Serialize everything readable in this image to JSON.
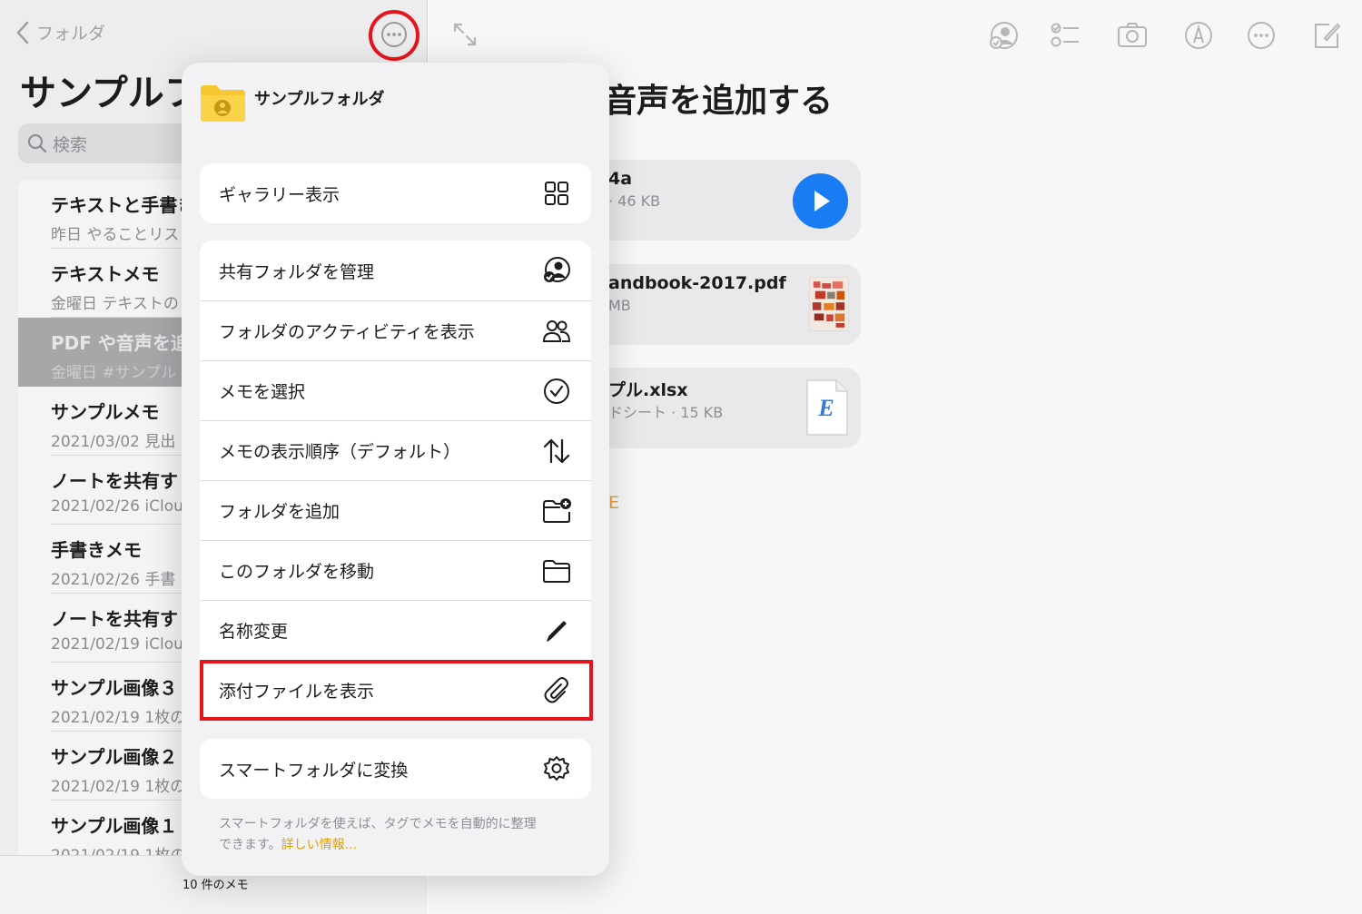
{
  "sidebar": {
    "back_label": "フォルダ",
    "title": "サンプルフ",
    "search_placeholder": "検索",
    "note_count": "10 件のメモ",
    "notes": [
      {
        "title": "テキストと手書き",
        "sub": "昨日  やることリスト"
      },
      {
        "title": "テキストメモ",
        "sub": "金曜日  テキストの"
      },
      {
        "title": "PDF や音声を追",
        "sub": "金曜日  #サンプル"
      },
      {
        "title": "サンプルメモ",
        "sub": "2021/03/02  見出"
      },
      {
        "title": "ノートを共有す",
        "sub": "2021/02/26  iClou"
      },
      {
        "title": "手書きメモ",
        "sub": "2021/02/26  手書"
      },
      {
        "title": "ノートを共有す",
        "sub": "2021/02/19  iClou"
      },
      {
        "title": "サンプル画像３",
        "sub": "2021/02/19  1枚の"
      },
      {
        "title": "サンプル画像２",
        "sub": "2021/02/19  1枚の"
      },
      {
        "title": "サンプル画像１",
        "sub": "2021/02/19  1枚の"
      }
    ]
  },
  "detail": {
    "title": "音声を追加する",
    "attachments": [
      {
        "name": "4a",
        "meta": "· 46 KB"
      },
      {
        "name": "andbook-2017.pdf",
        "meta": "MB"
      },
      {
        "name": "プル.xlsx",
        "meta": "ドシート · 15 KB"
      }
    ],
    "orange_text": "E"
  },
  "popover": {
    "folder_name": "サンプルフォルダ",
    "group1": [
      {
        "label": "ギャラリー表示",
        "icon": "gallery-grid-icon"
      }
    ],
    "group2": [
      {
        "label": "共有フォルダを管理",
        "icon": "shared-folder-icon"
      },
      {
        "label": "フォルダのアクティビティを表示",
        "icon": "people-icon"
      },
      {
        "label": "メモを選択",
        "icon": "checkmark-circle-icon"
      },
      {
        "label": "メモの表示順序（デフォルト）",
        "icon": "sort-arrows-icon"
      },
      {
        "label": "フォルダを追加",
        "icon": "folder-add-icon"
      },
      {
        "label": "このフォルダを移動",
        "icon": "folder-icon"
      },
      {
        "label": "名称変更",
        "icon": "pencil-icon"
      },
      {
        "label": "添付ファイルを表示",
        "icon": "paperclip-icon"
      }
    ],
    "group3": [
      {
        "label": "スマートフォルダに変換",
        "icon": "gear-icon"
      }
    ],
    "note_line1": "スマートフォルダを使えば、タグでメモを自動的に整理",
    "note_line2": "できます。",
    "learn_more": "詳しい情報..."
  },
  "colors": {
    "highlight": "#e8141b",
    "accent_blue": "#1a7cf5",
    "folder_yellow": "#f7c630",
    "learn_more": "#e0a000"
  }
}
